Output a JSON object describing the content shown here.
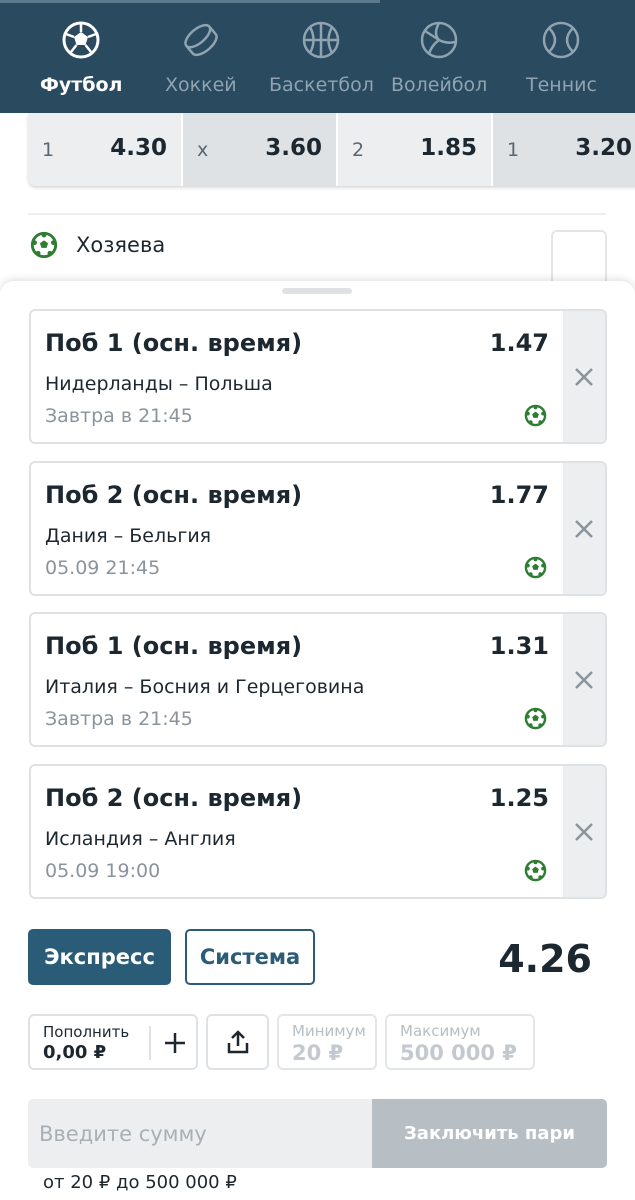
{
  "sport_nav": {
    "items": [
      {
        "label": "Футбол",
        "icon": "soccer-ball-icon",
        "active": true
      },
      {
        "label": "Хоккей",
        "icon": "hockey-puck-icon",
        "active": false
      },
      {
        "label": "Баскетбол",
        "icon": "basketball-icon",
        "active": false
      },
      {
        "label": "Волейбол",
        "icon": "volleyball-icon",
        "active": false
      },
      {
        "label": "Теннис",
        "icon": "tennis-ball-icon",
        "active": false
      }
    ]
  },
  "odds_row": [
    {
      "key": "1",
      "value": "4.30"
    },
    {
      "key": "x",
      "value": "3.60"
    },
    {
      "key": "2",
      "value": "1.85"
    },
    {
      "key": "1",
      "value": "3.20"
    }
  ],
  "hosts_label": "Хозяева",
  "bets": [
    {
      "title": "Поб 1 (осн. время)",
      "odd": "1.47",
      "teams": "Нидерланды – Польша",
      "time": "Завтра в 21:45",
      "icon": "soccer-ball-icon"
    },
    {
      "title": "Поб 2 (осн. время)",
      "odd": "1.77",
      "teams": "Дания – Бельгия",
      "time": "05.09 21:45",
      "icon": "soccer-ball-icon"
    },
    {
      "title": "Поб 1 (осн. время)",
      "odd": "1.31",
      "teams": "Италия – Босния и Герцеговина",
      "time": "Завтра в 21:45",
      "icon": "soccer-ball-icon"
    },
    {
      "title": "Поб 2 (осн. время)",
      "odd": "1.25",
      "teams": "Исландия – Англия",
      "time": "05.09 19:00",
      "icon": "soccer-ball-icon"
    }
  ],
  "bet_type": {
    "express_label": "Экспресс",
    "system_label": "Система",
    "selected": "Экспресс"
  },
  "total_odd": "4.26",
  "balance": {
    "label": "Пополнить",
    "value": "0,00 ₽"
  },
  "limits": {
    "min_label": "Минимум",
    "min_value": "20 ₽",
    "max_label": "Максимум",
    "max_value": "500 000 ₽"
  },
  "amount_input": {
    "placeholder": "Введите сумму",
    "value": ""
  },
  "submit_label": "Заключить пари",
  "range_hint": "от 20 ₽ до 500 000 ₽",
  "colors": {
    "nav_bg": "#2a4a60",
    "accent": "#2a5c78",
    "ball_green": "#2f7d32",
    "disabled": "#b7bec4"
  }
}
